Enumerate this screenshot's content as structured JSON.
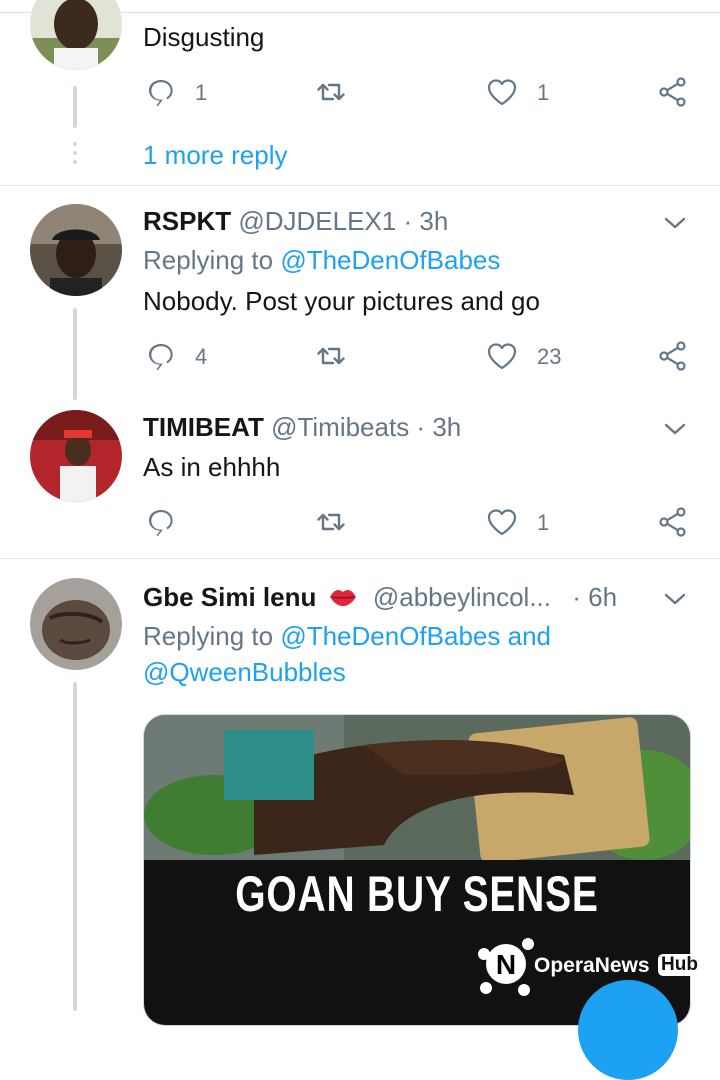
{
  "tweet0": {
    "text": "Disgusting",
    "reply_count": "1",
    "like_count": "1",
    "more_replies": "1 more reply"
  },
  "tweet1": {
    "name": "RSPKT",
    "handle": "@DJDELEX1",
    "separator": "·",
    "time": "3h",
    "replying_prefix": "Replying to",
    "replying_to": "@TheDenOfBabes",
    "text": "Nobody. Post your pictures and go",
    "reply_count": "4",
    "like_count": "23"
  },
  "tweet2": {
    "name": "TIMIBEAT",
    "handle": "@Timibeats",
    "separator": "·",
    "time": "3h",
    "text": "As in ehhhh",
    "like_count": "1"
  },
  "tweet3": {
    "name": "Gbe Simi lenu",
    "handle": "@abbeylincol...",
    "separator": "·",
    "time": "6h",
    "replying_prefix": "Replying to",
    "replying_to": "@TheDenOfBabes",
    "conjunction": "and",
    "replying_to_2": "@QweenBubbles",
    "media_caption": "GOAN BUY SENSE"
  },
  "watermark": {
    "brand": "OperaNews",
    "badge": "Hub"
  },
  "colors": {
    "accent": "#1da1f2",
    "secondary_text": "#657786",
    "thread_line": "#cfd9de",
    "separator": "#e1e8ed"
  },
  "icons": [
    "reply-icon",
    "retweet-icon",
    "like-icon",
    "share-icon",
    "chevron-down-icon",
    "lips-emoji-icon"
  ]
}
